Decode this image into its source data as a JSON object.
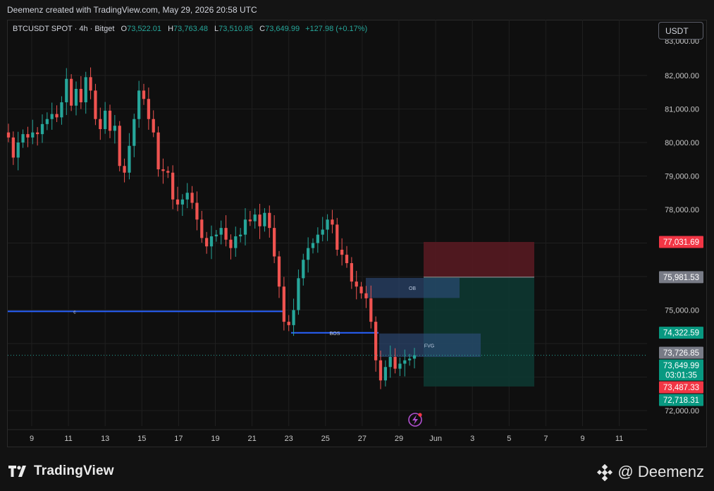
{
  "header": {
    "credit": "Deemenz created with TradingView.com, May 29, 2026 20:58 UTC"
  },
  "legend": {
    "symbol": "BTCUSDT SPOT · 4h · Bitget",
    "open_label": "O",
    "open": "73,522.01",
    "high_label": "H",
    "high": "73,763.48",
    "low_label": "L",
    "low": "73,510.85",
    "close_label": "C",
    "close": "73,649.99",
    "change": "+127.98 (+0.17%)"
  },
  "unit_button": "USDT",
  "colors": {
    "up": "#26a69a",
    "down": "#ef5350",
    "background": "#0f0f0f",
    "level_line": "#2962ff"
  },
  "chart_data": {
    "type": "candlestick",
    "x_ticks": [
      "9",
      "11",
      "13",
      "15",
      "17",
      "19",
      "21",
      "23",
      "25",
      "27",
      "29",
      "Jun",
      "3",
      "5",
      "7",
      "9",
      "11"
    ],
    "y_ticks": [
      "82,000.00",
      "81,000.00",
      "80,000.00",
      "79,000.00",
      "78,000.00",
      "75,000.00",
      "72,000.00"
    ],
    "y_range": [
      71700,
      83100
    ],
    "top_partial_tick": "83,000.00",
    "price_badges": [
      {
        "label": "77,031.69",
        "price": 77031.69,
        "color": "#f23645"
      },
      {
        "label": "75,981.53",
        "price": 75981.53,
        "color": "#787b86"
      },
      {
        "label": "74,322.59",
        "price": 74322.59,
        "color": "#089981"
      },
      {
        "label": "73,726.85",
        "price": 73726.85,
        "color": "#787b86"
      },
      {
        "label": "73,649.99",
        "sublabel": "03:01:35",
        "price": 73649.99,
        "color": "#089981"
      },
      {
        "label": "73,487.33",
        "price": 73487.33,
        "color": "#f23645"
      },
      {
        "label": "72,718.31",
        "price": 72718.31,
        "color": "#089981"
      }
    ],
    "annotations": [
      {
        "label": "c",
        "type": "level_line",
        "price": 74960
      },
      {
        "label": "BOS",
        "type": "level_line",
        "price": 74320
      },
      {
        "label": "OB",
        "type": "zone",
        "top": 75960,
        "bottom": 75360
      },
      {
        "label": "FVG",
        "type": "zone",
        "top": 74300,
        "bottom": 73600
      },
      {
        "type": "position_stop",
        "top": 77031.69,
        "bottom": 75981.53
      },
      {
        "type": "position_target",
        "top": 75981.53,
        "bottom": 72718.31
      }
    ],
    "closes": [
      80150,
      79550,
      80000,
      80250,
      80150,
      80300,
      80250,
      80550,
      80700,
      80850,
      80750,
      81200,
      81900,
      81100,
      81600,
      81200,
      81950,
      81550,
      80700,
      80400,
      80950,
      80350,
      80500,
      79300,
      79100,
      79900,
      80700,
      81550,
      81300,
      80700,
      80300,
      79200,
      79150,
      79100,
      78300,
      78150,
      78300,
      78500,
      78200,
      77700,
      77150,
      76900,
      77200,
      77250,
      77450,
      77100,
      76850,
      77200,
      77250,
      77700,
      77650,
      77850,
      77500,
      77900,
      77450,
      76600,
      75700,
      74650,
      74550,
      75000,
      75950,
      76500,
      76850,
      77000,
      77250,
      77400,
      77700,
      77550,
      76800,
      76650,
      76400,
      75850,
      75700,
      75500,
      75350,
      74650,
      73500,
      72900,
      73300,
      73600,
      73250,
      73400,
      73500,
      73549.99,
      73649.99
    ]
  }
}
